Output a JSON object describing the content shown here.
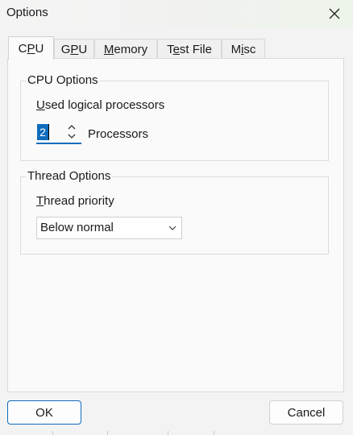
{
  "window": {
    "title": "Options"
  },
  "tabs": [
    {
      "label": "CPU",
      "mnemonic_index": 1,
      "active": true
    },
    {
      "label": "GPU",
      "mnemonic_index": 1,
      "active": false
    },
    {
      "label": "Memory",
      "mnemonic_index": 0,
      "active": false
    },
    {
      "label": "Test File",
      "mnemonic_index": 1,
      "active": false
    },
    {
      "label": "Misc",
      "mnemonic_index": 1,
      "active": false
    }
  ],
  "cpu_options": {
    "legend": "CPU Options",
    "used_logical_label": "Used logical processors",
    "used_logical_mnemonic_index": 0,
    "processor_count": "2",
    "units_label": "Processors"
  },
  "thread_options": {
    "legend": "Thread Options",
    "priority_label": "Thread priority",
    "priority_mnemonic_index": 0,
    "priority_value": "Below normal"
  },
  "buttons": {
    "ok": "OK",
    "cancel": "Cancel"
  },
  "colors": {
    "accent": "#0f6cbd",
    "background": "#f3f3f3",
    "panel": "#fafafa"
  },
  "icons": {
    "close": "close-icon",
    "spin_up": "chevron-up-icon",
    "spin_down": "chevron-down-icon",
    "combo": "chevron-down-icon"
  }
}
